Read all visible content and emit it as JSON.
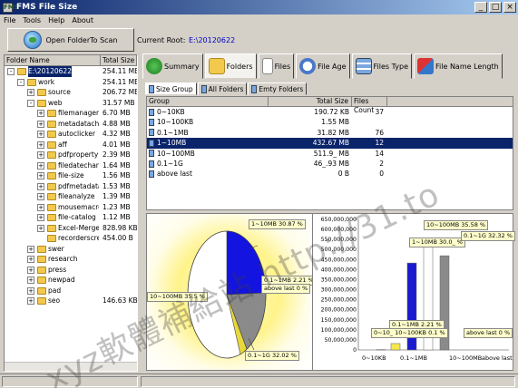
{
  "window": {
    "title": "FMS File Size",
    "app_icon": "FMS"
  },
  "menu": [
    "File",
    "Tools",
    "Help",
    "About"
  ],
  "toolbar": {
    "open_label": "Open FolderTo Scan",
    "root_label": "Current Root:",
    "root_value": "E:\\20120622"
  },
  "tree": {
    "columns": [
      "Folder Name",
      "Total Size"
    ],
    "rows": [
      {
        "name": "E:\\20120622",
        "size": "254.11 MB",
        "indent": 0,
        "exp": "-",
        "selected": true
      },
      {
        "name": "work",
        "size": "254.11 MB",
        "indent": 1,
        "exp": "-"
      },
      {
        "name": "source",
        "size": "206.72 MB",
        "indent": 2,
        "exp": "+"
      },
      {
        "name": "web",
        "size": "31.57 MB",
        "indent": 2,
        "exp": "-"
      },
      {
        "name": "filemanagersoft",
        "size": "6.70 MB",
        "indent": 3,
        "exp": "+"
      },
      {
        "name": "metadatachan",
        "size": "4.88 MB",
        "indent": 3,
        "exp": "+"
      },
      {
        "name": "autoclicker",
        "size": "4.32 MB",
        "indent": 3,
        "exp": "+"
      },
      {
        "name": "aff",
        "size": "4.01 MB",
        "indent": 3,
        "exp": "+"
      },
      {
        "name": "pdfproperty",
        "size": "2.39 MB",
        "indent": 3,
        "exp": "+"
      },
      {
        "name": "filedatechanger",
        "size": "1.64 MB",
        "indent": 3,
        "exp": "+"
      },
      {
        "name": "file-size",
        "size": "1.56 MB",
        "indent": 3,
        "exp": "+"
      },
      {
        "name": "pdfmetadatae",
        "size": "1.53 MB",
        "indent": 3,
        "exp": "+"
      },
      {
        "name": "fileanalyze",
        "size": "1.39 MB",
        "indent": 3,
        "exp": "+"
      },
      {
        "name": "mousemacror",
        "size": "1.23 MB",
        "indent": 3,
        "exp": "+"
      },
      {
        "name": "file-catalog",
        "size": "1.12 MB",
        "indent": 3,
        "exp": "+"
      },
      {
        "name": "Excel-Merge",
        "size": "828.98 KB",
        "indent": 3,
        "exp": "+"
      },
      {
        "name": "recorderscreen",
        "size": "454.00 B",
        "indent": 3,
        "exp": ""
      },
      {
        "name": "swer",
        "size": "",
        "indent": 2,
        "exp": "+"
      },
      {
        "name": "research",
        "size": "",
        "indent": 2,
        "exp": "+"
      },
      {
        "name": "press",
        "size": "",
        "indent": 2,
        "exp": "+"
      },
      {
        "name": "newpad",
        "size": "",
        "indent": 2,
        "exp": "+"
      },
      {
        "name": "pad",
        "size": "",
        "indent": 2,
        "exp": "+"
      },
      {
        "name": "seo",
        "size": "146.63 KB",
        "indent": 2,
        "exp": "+"
      }
    ]
  },
  "tabs": [
    {
      "label": "Summary",
      "icon": "summary-icon"
    },
    {
      "label": "Folders",
      "icon": "folder-icon",
      "active": true
    },
    {
      "label": "Files",
      "icon": "file-icon"
    },
    {
      "label": "File Age",
      "icon": "clock-icon"
    },
    {
      "label": "Files Type",
      "icon": "filetype-icon"
    },
    {
      "label": "File Name Length",
      "icon": "filename-icon"
    }
  ],
  "subtabs": [
    "Size Group",
    "All Folders",
    "Emty Folders"
  ],
  "grid": {
    "columns": [
      "Group",
      "Total Size",
      "Files Count"
    ],
    "rows": [
      {
        "group": "0~10KB",
        "size": "190.72 KB",
        "count": "37"
      },
      {
        "group": "10~100KB",
        "size": "1.55 MB",
        "count": ""
      },
      {
        "group": "0.1~1MB",
        "size": "31.82 MB",
        "count": "76"
      },
      {
        "group": "1~10MB",
        "size": "432.67 MB",
        "count": "12",
        "selected": true
      },
      {
        "group": "10~100MB",
        "size": "511.9_ MB",
        "count": "14"
      },
      {
        "group": "0.1~1G",
        "size": "46_.93 MB",
        "count": "2"
      },
      {
        "group": "above last",
        "size": "0 B",
        "count": "0"
      }
    ]
  },
  "pie_labels": {
    "l1": "1~10MB 30.87 %",
    "l2": "10~100MB 35.5 %",
    "l3": "0.1~1G 32.02 %",
    "l4": "0.1~1MB 2.21 %",
    "l5": "above last 0 %"
  },
  "chart_data": {
    "type": "bar",
    "categories": [
      "0~10KB",
      "0.1~1MB",
      "10~100MB",
      "above last"
    ],
    "values": [
      0,
      31820000,
      432670000,
      511900000,
      468930000,
      0
    ],
    "bars": [
      {
        "label": "0~10KB",
        "value": 0,
        "color": "#2b2bd6"
      },
      {
        "label": "10~100KB",
        "value": 1550000,
        "color": "#2b2bd6"
      },
      {
        "label": "0.1~1MB",
        "value": 31820000,
        "color": "#f5e84a"
      },
      {
        "label": "1~10MB",
        "value": 432670000,
        "color": "#1a1ad0"
      },
      {
        "label": "10~100MB",
        "value": 511900000,
        "color": "#ffffff"
      },
      {
        "label": "0.1~1G",
        "value": 468930000,
        "color": "#8a8a8a"
      },
      {
        "label": "above last",
        "value": 0,
        "color": "#8a8a8a"
      }
    ],
    "yticks": [
      "0",
      "50,000,000",
      "100,000,000",
      "150,000,000",
      "200,000,000",
      "250,000,000",
      "300,000,000",
      "350,000,000",
      "400,000,000",
      "450,000,000",
      "500,000,000",
      "550,000,000",
      "600,000,000",
      "650,000,000"
    ],
    "ylim": [
      0,
      650000000
    ],
    "labels": {
      "b1": "10~100MB 35.58 %",
      "b2": "1~10MB 30.0_ %",
      "b3": "0.1~1G 32.32 %",
      "b4": "0.1~1MB 2.21 %",
      "b5": "0~10_ 10~100KB 0.1 %",
      "b6": "above last 0 %"
    }
  },
  "watermark": "xyz軟體補給站 http://31.to"
}
